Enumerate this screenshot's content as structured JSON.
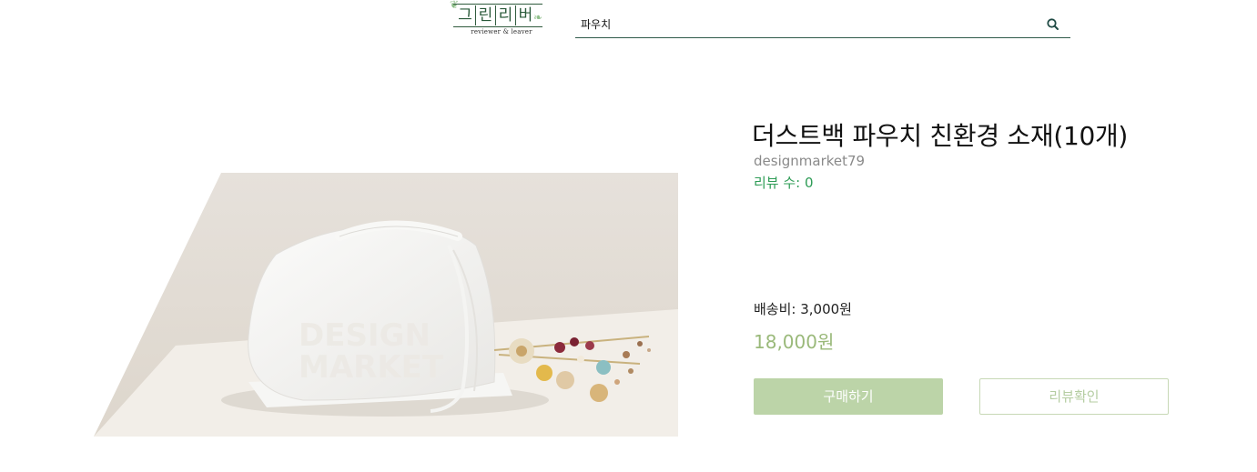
{
  "header": {
    "logo": {
      "chars": [
        "그",
        "린",
        "리",
        "버"
      ],
      "subtitle": "reviewer & leaver"
    },
    "search": {
      "value": "파우치",
      "icon": "search-icon"
    }
  },
  "product": {
    "image_watermark": [
      "DESIGN",
      "MARKET"
    ],
    "title": "더스트백 파우치 친환경 소재(10개)",
    "seller": "designmarket79",
    "review_count": "리뷰 수: 0",
    "shipping": "배송비: 3,000원",
    "price": "18,000원",
    "buy_label": "구매하기",
    "review_label": "리뷰확인"
  },
  "colors": {
    "brand_green": "#2f5a3c",
    "review_green": "#2e9c56",
    "price_green": "#9ab97a",
    "buy_button": "#bcd4a8"
  }
}
